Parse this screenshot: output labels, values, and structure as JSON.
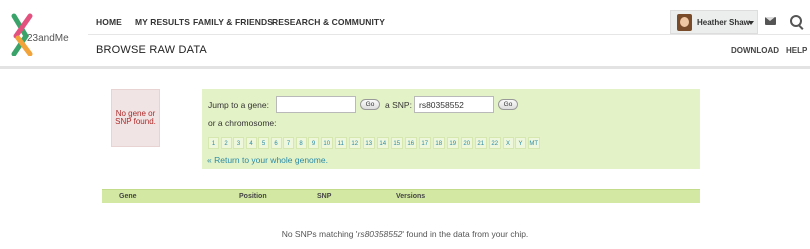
{
  "brand": {
    "logo_text": "23andMe"
  },
  "nav": {
    "items": [
      "HOME",
      "MY RESULTS",
      "FAMILY & FRIENDS",
      "RESEARCH & COMMUNITY"
    ]
  },
  "user": {
    "name": "Heather Shaw"
  },
  "page": {
    "title": "BROWSE RAW DATA",
    "links": [
      "DOWNLOAD",
      "HELP"
    ]
  },
  "not_found": {
    "message": "No gene or SNP found."
  },
  "search": {
    "gene_label": "Jump to a gene:",
    "gene_value": "",
    "go_label": "Go",
    "snp_label": "a SNP:",
    "snp_value": "rs80358552",
    "chromosome_label": "or a chromosome:",
    "chromosomes": [
      "1",
      "2",
      "3",
      "4",
      "5",
      "6",
      "7",
      "8",
      "9",
      "10",
      "11",
      "12",
      "13",
      "14",
      "15",
      "16",
      "17",
      "18",
      "19",
      "20",
      "21",
      "22",
      "X",
      "Y",
      "MT"
    ],
    "return_link": "« Return to your whole genome."
  },
  "table": {
    "headers": [
      "Gene",
      "Position",
      "SNP",
      "Versions"
    ]
  },
  "result": {
    "prefix": "No SNPs matching '",
    "query": "rs80358552",
    "suffix": "' found in the data from your chip."
  },
  "colors": {
    "panel": "#e4f2c7",
    "table_header": "#d3e8a3",
    "link": "#2a8aa5",
    "error": "#b02a2a"
  }
}
